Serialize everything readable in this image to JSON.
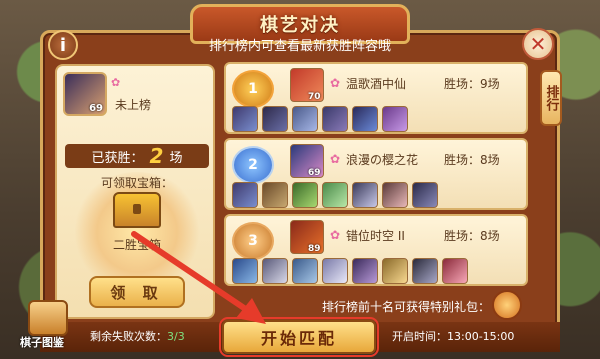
{
  "header": {
    "title": "棋艺对决",
    "subtitle": "排行榜内可查看最新获胜阵容哦"
  },
  "player": {
    "level": "69",
    "rank_status": "未上榜",
    "wins_prefix": "已获胜：",
    "wins_value": "2",
    "wins_suffix": "场",
    "chest_prompt": "可领取宝箱：",
    "chest_name": "二胜宝箱",
    "claim_label": "领 取"
  },
  "side_tab": {
    "label": "排行"
  },
  "rankings": [
    {
      "rank": "1",
      "name": "温歌酒中仙",
      "wins": "胜场：9场",
      "level": "70",
      "pieces": 6
    },
    {
      "rank": "2",
      "name": "浪漫の樱之花",
      "wins": "胜场：8场",
      "level": "69",
      "pieces": 7
    },
    {
      "rank": "3",
      "name": "错位时空 II",
      "wins": "胜场：8场",
      "level": "89",
      "pieces": 8
    }
  ],
  "footer": {
    "note": "排行榜前十名可获得特别礼包：",
    "handbook_label": "棋子图鉴",
    "remaining_label": "剩余失败次数：",
    "remaining_value": "3/3",
    "start_button": "开始匹配",
    "open_time": "开启时间：13:00-15:00"
  },
  "colors": {
    "frame": "#8a3f1b",
    "accent_gold": "#ffd040",
    "highlight_red": "#e63b2a"
  }
}
